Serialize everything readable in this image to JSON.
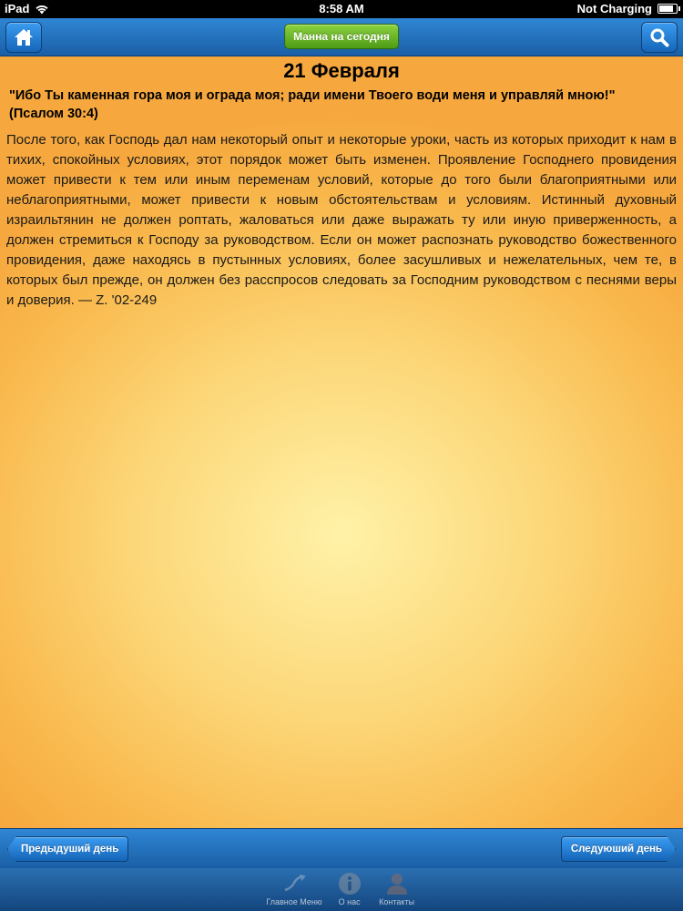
{
  "status_bar": {
    "device": "iPad",
    "time": "8:58 AM",
    "charging": "Not Charging",
    "battery_level": 0.9
  },
  "top_bar": {
    "home_icon": "home-icon",
    "today_label": "Манна на сегодня",
    "search_icon": "search-icon"
  },
  "content": {
    "date": "21 Февраля",
    "verse_text": "\"Ибо Ты каменная гора моя и ограда моя; ради имени Твоего води меня и управляй мною!\"",
    "verse_ref": "(Псалом 30:4)",
    "body": "После того, как Господь дал нам некоторый опыт и некоторые уроки, часть из которых приходит к нам в тихих, спокойных условиях, этот порядок может быть изменен. Проявление Господнего провидения может привести к тем или иным переменам условий, которые до того были благоприятными или неблагоприятными, может привести к новым обстоятельствам и условиям. Истинный духовный израильтянин не должен роптать, жаловаться или даже выражать ту или иную приверженность, а должен стремиться к Господу за руководством. Если он может распознать руководство божественного провидения, даже находясь в пустынных условиях, более засушливых и нежелательных, чем те, в которых был прежде, он должен без расспросов следовать за Господним руководством с песнями веры и доверия. — Z. '02-249"
  },
  "bottom_bar": {
    "prev_label": "Предыдуший день",
    "next_label": "Следуюший день"
  },
  "tab_bar": {
    "items": [
      {
        "label": "Главное Меню",
        "icon": "main-menu-icon"
      },
      {
        "label": "О нас",
        "icon": "info-icon"
      },
      {
        "label": "Контакты",
        "icon": "contacts-icon"
      }
    ]
  },
  "colors": {
    "nav_blue": "#1a5fa6",
    "today_green": "#4e9b16",
    "content_gold": "#f9b84c"
  }
}
